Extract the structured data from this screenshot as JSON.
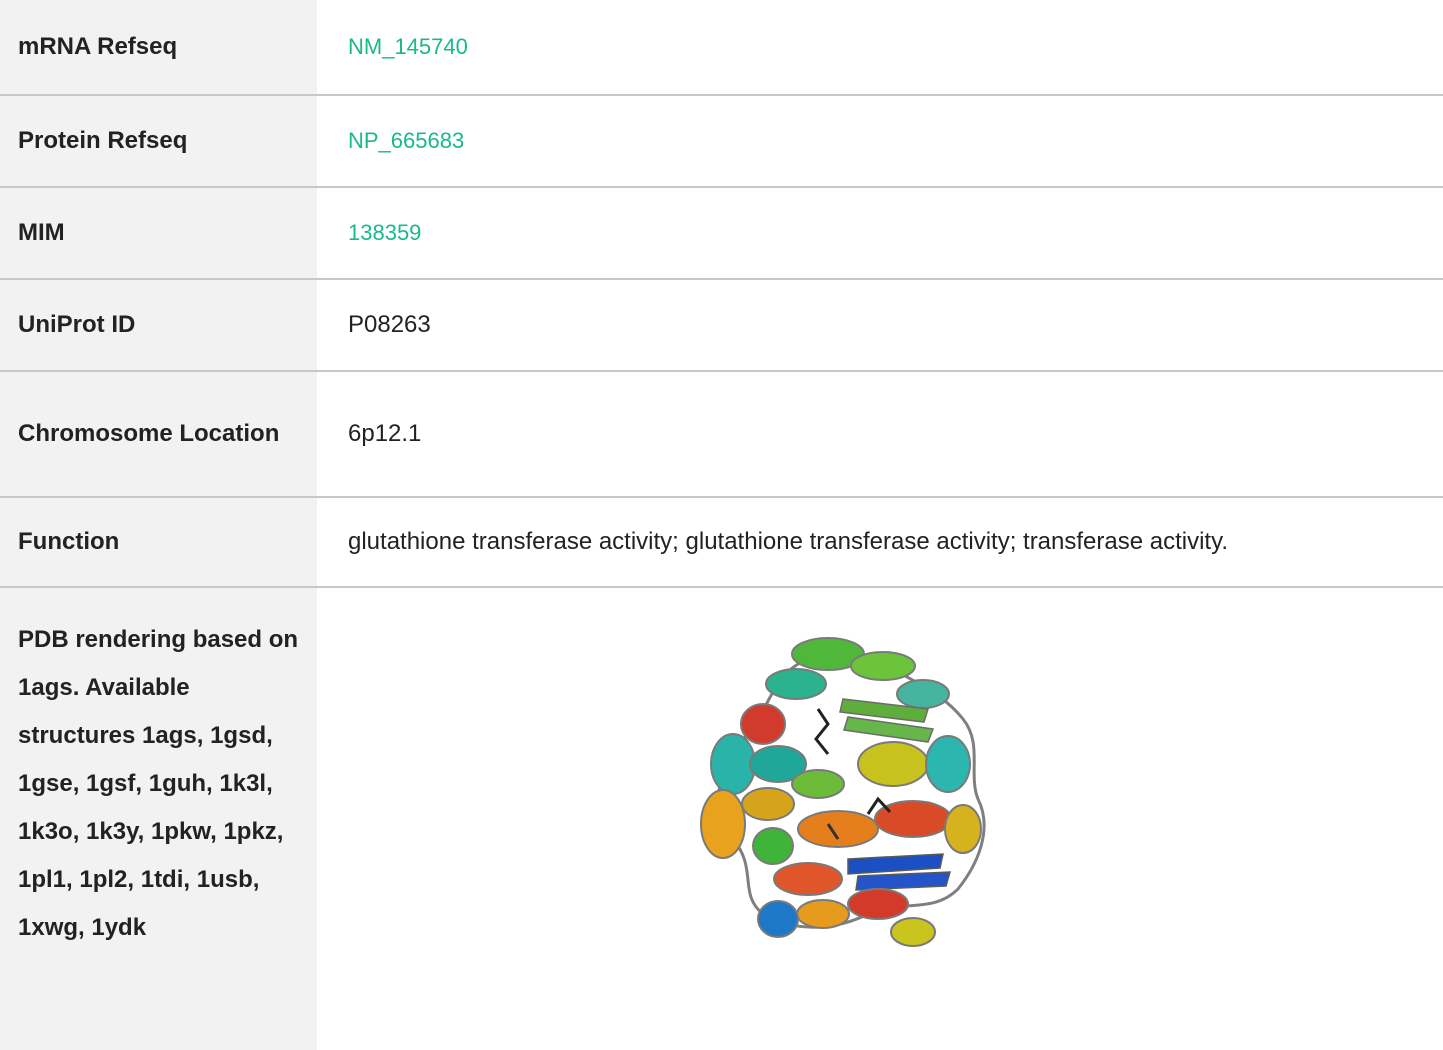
{
  "rows": [
    {
      "label": "mRNA Refseq",
      "value": "NM_145740",
      "is_link": true
    },
    {
      "label": "Protein Refseq",
      "value": "NP_665683",
      "is_link": true
    },
    {
      "label": "MIM",
      "value": "138359",
      "is_link": true
    },
    {
      "label": "UniProt ID",
      "value": "P08263",
      "is_link": false
    },
    {
      "label": "Chromosome Location",
      "value": "6p12.1",
      "is_link": false
    },
    {
      "label": "Function",
      "value": "glutathione transferase activity; glutathione transferase activity; transferase activity.",
      "is_link": false
    },
    {
      "label": "PDB rendering based on 1ags. Available structures 1ags, 1gsd, 1gse, 1gsf, 1guh, 1k3l, 1k3o, 1k3y, 1pkw, 1pkz, 1pl1, 1pl2, 1tdi, 1usb, 1xwg, 1ydk",
      "value": "",
      "is_link": false
    }
  ],
  "colors": {
    "link": "#19b98c",
    "label_background": "#f2f2f2",
    "divider": "#c8c8c8"
  }
}
